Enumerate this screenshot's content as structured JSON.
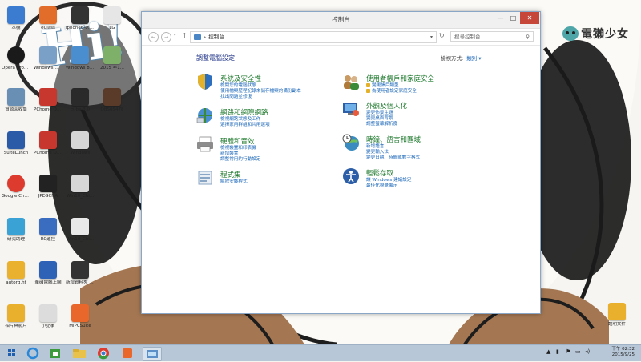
{
  "desktop": {
    "wallpaper_text": "Hi!",
    "brand_text": "電獺少女",
    "icons_left": [
      {
        "label": "本機",
        "color": "#3b7bd0"
      },
      {
        "label": "Opera Broadcast",
        "color": "#1a1a1a"
      },
      {
        "label": "資源回收筒",
        "color": "#6a8fb5"
      },
      {
        "label": "SuiteLunch",
        "color": "#2b5aa6"
      },
      {
        "label": "Google Chrome",
        "color": "#dc3b2e"
      },
      {
        "label": "研究助理",
        "color": "#3aa2d4"
      },
      {
        "label": "autorg.ht",
        "color": "#e9b12d"
      },
      {
        "label": "相片與影片",
        "color": "#e8b02d"
      }
    ],
    "icons_col2": [
      {
        "label": "eClass",
        "color": "#e26d2a"
      },
      {
        "label": "Windows M...",
        "color": "#7aa0c8"
      },
      {
        "label": "PChome Online - 購...",
        "color": "#c8372d"
      },
      {
        "label": "PChome Online - 購...",
        "color": "#c8372d"
      },
      {
        "label": "JPEGCHA",
        "color": "#222222"
      },
      {
        "label": "RC遙控",
        "color": "#3a6dbf"
      },
      {
        "label": "華碩電腦上網",
        "color": "#2d62b6"
      },
      {
        "label": "小記事",
        "color": "#dcdcdc"
      }
    ],
    "icons_col3": [
      {
        "label": "iphone6-0.8...",
        "color": "#333333"
      },
      {
        "label": "Windows 8.1 Pro DVD...",
        "color": "#4a8ed0"
      },
      {
        "label": "cube-3.0",
        "color": "#2a2a2a"
      },
      {
        "label": "Windows",
        "color": "#d6d6d6"
      },
      {
        "label": "Win10_Chi...",
        "color": "#d6d6d6"
      },
      {
        "label": "Win10_Chi...",
        "color": "#e9e9e9"
      },
      {
        "label": "新增資料夾 (2)",
        "color": "#333333"
      },
      {
        "label": "MiPCSuite",
        "color": "#e9672a"
      }
    ],
    "icons_col4": [
      {
        "label": "LG",
        "color": "#e6e6e6"
      },
      {
        "label": "2015 年1...",
        "color": "#7fb069"
      },
      {
        "label": "OBS0S478",
        "color": "#5a3b2a"
      }
    ],
    "icon_right": {
      "label": "說明文件",
      "color": "#e8b02d"
    }
  },
  "window": {
    "title": "控制台",
    "controls": {
      "minimize": "—",
      "maximize": "□",
      "close": "✕"
    },
    "address": {
      "path": "控制台",
      "separator": "▸"
    },
    "search_placeholder": "搜尋控制台",
    "heading": "調整電腦設定",
    "view_by_label": "檢視方式:",
    "view_by_value": "類別 ▾",
    "categories": [
      {
        "title": "系統及安全性",
        "icon": "shield-icon",
        "color": "#2e6fbd",
        "links": [
          "檢閱您的電腦狀態",
          "使用檔案歷程記錄來儲存檔案的備份副本",
          "找出問題並修復"
        ]
      },
      {
        "title": "網路和網際網路",
        "icon": "network-icon",
        "color": "#3b8a3a",
        "links": [
          "檢視網路狀態及工作",
          "選擇家用群組和共用選項"
        ]
      },
      {
        "title": "硬體和音效",
        "icon": "printer-icon",
        "color": "#6b6b6b",
        "links": [
          "檢視裝置和印表機",
          "新增裝置",
          "調整常用的行動設定"
        ]
      },
      {
        "title": "程式集",
        "icon": "programs-icon",
        "color": "#8aa6c6",
        "links": [
          "解除安裝程式"
        ]
      },
      {
        "title": "使用者帳戶和家庭安全",
        "icon": "users-icon",
        "color": "#b07a3a",
        "links": [
          "變更帳戶類型",
          "為使用者設定家庭安全"
        ]
      },
      {
        "title": "外觀及個人化",
        "icon": "appearance-icon",
        "color": "#2c5fa8",
        "links": [
          "變更佈景主題",
          "變更桌面背景",
          "調整螢幕解析度"
        ]
      },
      {
        "title": "時鐘、語言和區域",
        "icon": "clock-globe-icon",
        "color": "#3a8bbf",
        "links": [
          "新增語言",
          "變更輸入法",
          "變更日期、時間或數字格式"
        ]
      },
      {
        "title": "輕鬆存取",
        "icon": "accessibility-icon",
        "color": "#2d5fa8",
        "links": [
          "讓 Windows 建議設定",
          "最佳化視覺顯示"
        ]
      }
    ]
  },
  "taskbar": {
    "apps": [
      {
        "name": "start-button",
        "color": "#1f5fb0"
      },
      {
        "name": "ie-icon",
        "color": "#2a86d6"
      },
      {
        "name": "store-icon",
        "color": "#3b9a3b"
      },
      {
        "name": "explorer-icon",
        "color": "#e8c24a"
      },
      {
        "name": "chrome-icon",
        "color": "#dc3b2e"
      },
      {
        "name": "mi-icon",
        "color": "#e9672a"
      },
      {
        "name": "control-panel-icon",
        "color": "#5a8fc8"
      }
    ],
    "clock_time": "下午 02:32",
    "clock_date": "2015/9/25"
  }
}
